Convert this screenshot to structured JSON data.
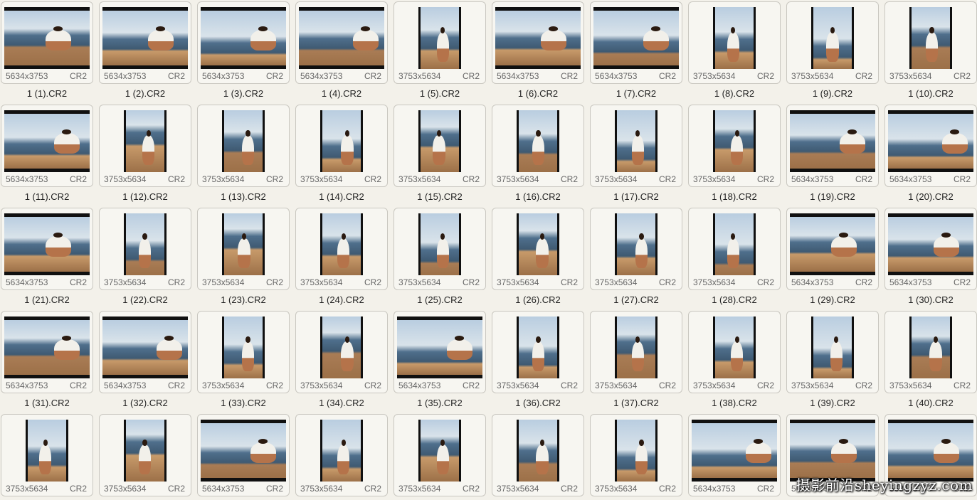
{
  "files": [
    {
      "name": "1 (1).CR2",
      "dims": "5634x3753",
      "ext": "CR2",
      "orientation": "landscape"
    },
    {
      "name": "1 (2).CR2",
      "dims": "5634x3753",
      "ext": "CR2",
      "orientation": "landscape"
    },
    {
      "name": "1 (3).CR2",
      "dims": "5634x3753",
      "ext": "CR2",
      "orientation": "landscape"
    },
    {
      "name": "1 (4).CR2",
      "dims": "5634x3753",
      "ext": "CR2",
      "orientation": "landscape"
    },
    {
      "name": "1 (5).CR2",
      "dims": "3753x5634",
      "ext": "CR2",
      "orientation": "portrait"
    },
    {
      "name": "1 (6).CR2",
      "dims": "5634x3753",
      "ext": "CR2",
      "orientation": "landscape"
    },
    {
      "name": "1 (7).CR2",
      "dims": "5634x3753",
      "ext": "CR2",
      "orientation": "landscape"
    },
    {
      "name": "1 (8).CR2",
      "dims": "3753x5634",
      "ext": "CR2",
      "orientation": "portrait"
    },
    {
      "name": "1 (9).CR2",
      "dims": "3753x5634",
      "ext": "CR2",
      "orientation": "portrait"
    },
    {
      "name": "1 (10).CR2",
      "dims": "3753x5634",
      "ext": "CR2",
      "orientation": "portrait"
    },
    {
      "name": "1 (11).CR2",
      "dims": "5634x3753",
      "ext": "CR2",
      "orientation": "landscape"
    },
    {
      "name": "1 (12).CR2",
      "dims": "3753x5634",
      "ext": "CR2",
      "orientation": "portrait"
    },
    {
      "name": "1 (13).CR2",
      "dims": "3753x5634",
      "ext": "CR2",
      "orientation": "portrait"
    },
    {
      "name": "1 (14).CR2",
      "dims": "3753x5634",
      "ext": "CR2",
      "orientation": "portrait"
    },
    {
      "name": "1 (15).CR2",
      "dims": "3753x5634",
      "ext": "CR2",
      "orientation": "portrait"
    },
    {
      "name": "1 (16).CR2",
      "dims": "3753x5634",
      "ext": "CR2",
      "orientation": "portrait"
    },
    {
      "name": "1 (17).CR2",
      "dims": "3753x5634",
      "ext": "CR2",
      "orientation": "portrait"
    },
    {
      "name": "1 (18).CR2",
      "dims": "3753x5634",
      "ext": "CR2",
      "orientation": "portrait"
    },
    {
      "name": "1 (19).CR2",
      "dims": "5634x3753",
      "ext": "CR2",
      "orientation": "landscape"
    },
    {
      "name": "1 (20).CR2",
      "dims": "5634x3753",
      "ext": "CR2",
      "orientation": "landscape"
    },
    {
      "name": "1 (21).CR2",
      "dims": "5634x3753",
      "ext": "CR2",
      "orientation": "landscape"
    },
    {
      "name": "1 (22).CR2",
      "dims": "3753x5634",
      "ext": "CR2",
      "orientation": "portrait"
    },
    {
      "name": "1 (23).CR2",
      "dims": "3753x5634",
      "ext": "CR2",
      "orientation": "portrait"
    },
    {
      "name": "1 (24).CR2",
      "dims": "3753x5634",
      "ext": "CR2",
      "orientation": "portrait"
    },
    {
      "name": "1 (25).CR2",
      "dims": "3753x5634",
      "ext": "CR2",
      "orientation": "portrait"
    },
    {
      "name": "1 (26).CR2",
      "dims": "3753x5634",
      "ext": "CR2",
      "orientation": "portrait"
    },
    {
      "name": "1 (27).CR2",
      "dims": "3753x5634",
      "ext": "CR2",
      "orientation": "portrait"
    },
    {
      "name": "1 (28).CR2",
      "dims": "3753x5634",
      "ext": "CR2",
      "orientation": "portrait"
    },
    {
      "name": "1 (29).CR2",
      "dims": "5634x3753",
      "ext": "CR2",
      "orientation": "landscape"
    },
    {
      "name": "1 (30).CR2",
      "dims": "5634x3753",
      "ext": "CR2",
      "orientation": "landscape"
    },
    {
      "name": "1 (31).CR2",
      "dims": "5634x3753",
      "ext": "CR2",
      "orientation": "landscape"
    },
    {
      "name": "1 (32).CR2",
      "dims": "5634x3753",
      "ext": "CR2",
      "orientation": "landscape"
    },
    {
      "name": "1 (33).CR2",
      "dims": "3753x5634",
      "ext": "CR2",
      "orientation": "portrait"
    },
    {
      "name": "1 (34).CR2",
      "dims": "3753x5634",
      "ext": "CR2",
      "orientation": "portrait"
    },
    {
      "name": "1 (35).CR2",
      "dims": "5634x3753",
      "ext": "CR2",
      "orientation": "landscape"
    },
    {
      "name": "1 (36).CR2",
      "dims": "3753x5634",
      "ext": "CR2",
      "orientation": "portrait"
    },
    {
      "name": "1 (37).CR2",
      "dims": "3753x5634",
      "ext": "CR2",
      "orientation": "portrait"
    },
    {
      "name": "1 (38).CR2",
      "dims": "3753x5634",
      "ext": "CR2",
      "orientation": "portrait"
    },
    {
      "name": "1 (39).CR2",
      "dims": "3753x5634",
      "ext": "CR2",
      "orientation": "portrait"
    },
    {
      "name": "1 (40).CR2",
      "dims": "3753x5634",
      "ext": "CR2",
      "orientation": "portrait"
    },
    {
      "name": "",
      "dims": "3753x5634",
      "ext": "CR2",
      "orientation": "portrait"
    },
    {
      "name": "",
      "dims": "3753x5634",
      "ext": "CR2",
      "orientation": "portrait"
    },
    {
      "name": "",
      "dims": "5634x3753",
      "ext": "CR2",
      "orientation": "landscape"
    },
    {
      "name": "",
      "dims": "3753x5634",
      "ext": "CR2",
      "orientation": "portrait"
    },
    {
      "name": "",
      "dims": "3753x5634",
      "ext": "CR2",
      "orientation": "portrait"
    },
    {
      "name": "",
      "dims": "3753x5634",
      "ext": "CR2",
      "orientation": "portrait"
    },
    {
      "name": "",
      "dims": "3753x5634",
      "ext": "CR2",
      "orientation": "portrait"
    },
    {
      "name": "",
      "dims": "5634x3753",
      "ext": "CR2",
      "orientation": "landscape"
    },
    {
      "name": "",
      "dims": "5634x3753",
      "ext": "CR2",
      "orientation": "landscape"
    },
    {
      "name": "",
      "dims": "5634x3753",
      "ext": "CR2",
      "orientation": "landscape"
    }
  ],
  "watermark": "摄影前沿sheyingzyz.com",
  "colors": {
    "sky": "#b9cde0",
    "sea": "#4f6f8c",
    "sand": "#c79a6a",
    "shirt": "#f2f0ea",
    "skin": "#b5734a"
  }
}
